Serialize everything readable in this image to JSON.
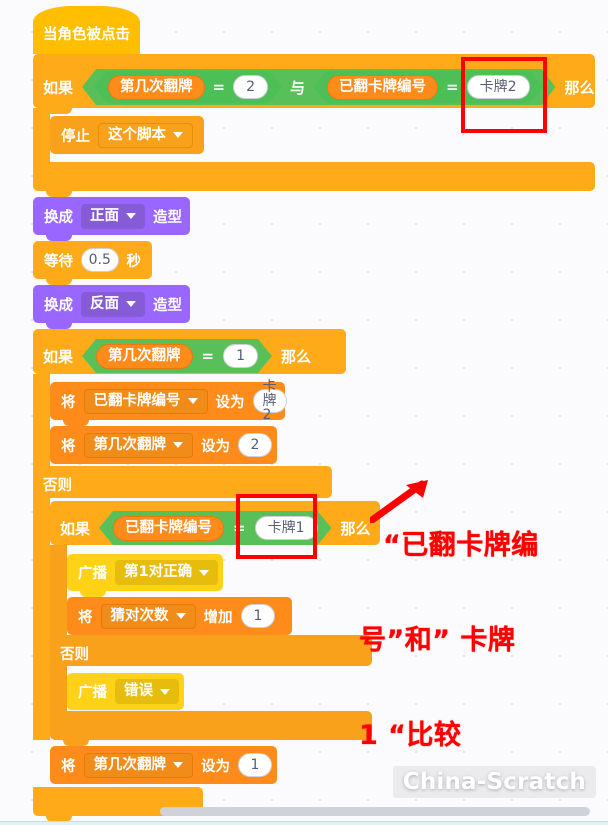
{
  "app": {
    "watermark": "China-Scratch",
    "background": "#fbfbfd"
  },
  "colors": {
    "events": "#ffbf00",
    "control": "#ffab19",
    "looks": "#9966ff",
    "data": "#ff8c1a",
    "operators": "#59c059",
    "highlight_box": "#ff0000",
    "annotation_text": "#ff0000"
  },
  "script": {
    "hat": {
      "label": "当角色被点击"
    },
    "main_if": {
      "if_label": "如果",
      "then_label": "那么",
      "condition": {
        "operator": "与",
        "left": {
          "variable": "第几次翻牌",
          "comparator": "=",
          "value": "2"
        },
        "right": {
          "variable": "已翻卡牌编号",
          "comparator": "=",
          "value": "卡牌2",
          "highlighted": true
        }
      },
      "body": [
        {
          "type": "stop",
          "label": "停止",
          "option": "这个脚本"
        }
      ]
    },
    "switch_costume_1": {
      "prefix": "换成",
      "costume": "正面",
      "suffix": "造型"
    },
    "wait": {
      "prefix": "等待",
      "value": "0.5",
      "suffix": "秒"
    },
    "switch_costume_2": {
      "prefix": "换成",
      "costume": "反面",
      "suffix": "造型"
    },
    "second_if": {
      "if_label": "如果",
      "then_label": "那么",
      "else_label": "否则",
      "condition": {
        "variable": "第几次翻牌",
        "comparator": "=",
        "value": "1"
      },
      "then_body": [
        {
          "type": "set",
          "prefix": "将",
          "variable": "已翻卡牌编号",
          "mid": "设为",
          "value": "卡牌2"
        },
        {
          "type": "set",
          "prefix": "将",
          "variable": "第几次翻牌",
          "mid": "设为",
          "value": "2"
        }
      ],
      "else_body": {
        "inner_if": {
          "if_label": "如果",
          "then_label": "那么",
          "else_label": "否则",
          "condition": {
            "variable": "已翻卡牌编号",
            "comparator": "=",
            "value": "卡牌1",
            "highlighted": true
          },
          "then_body": [
            {
              "type": "broadcast",
              "prefix": "广播",
              "message": "第1对正确"
            },
            {
              "type": "change",
              "prefix": "将",
              "variable": "猜对次数",
              "mid": "增加",
              "value": "1"
            }
          ],
          "else_body": [
            {
              "type": "broadcast",
              "prefix": "广播",
              "message": "错误"
            }
          ]
        },
        "after_inner": [
          {
            "type": "set",
            "prefix": "将",
            "variable": "第几次翻牌",
            "mid": "设为",
            "value": "1"
          }
        ]
      }
    }
  },
  "annotation": {
    "line1": "“已翻卡牌编",
    "line2": "号”和” 卡牌",
    "line3": "1 “比较",
    "full_text": "“已翻卡牌编号”和”卡牌1“比较"
  }
}
